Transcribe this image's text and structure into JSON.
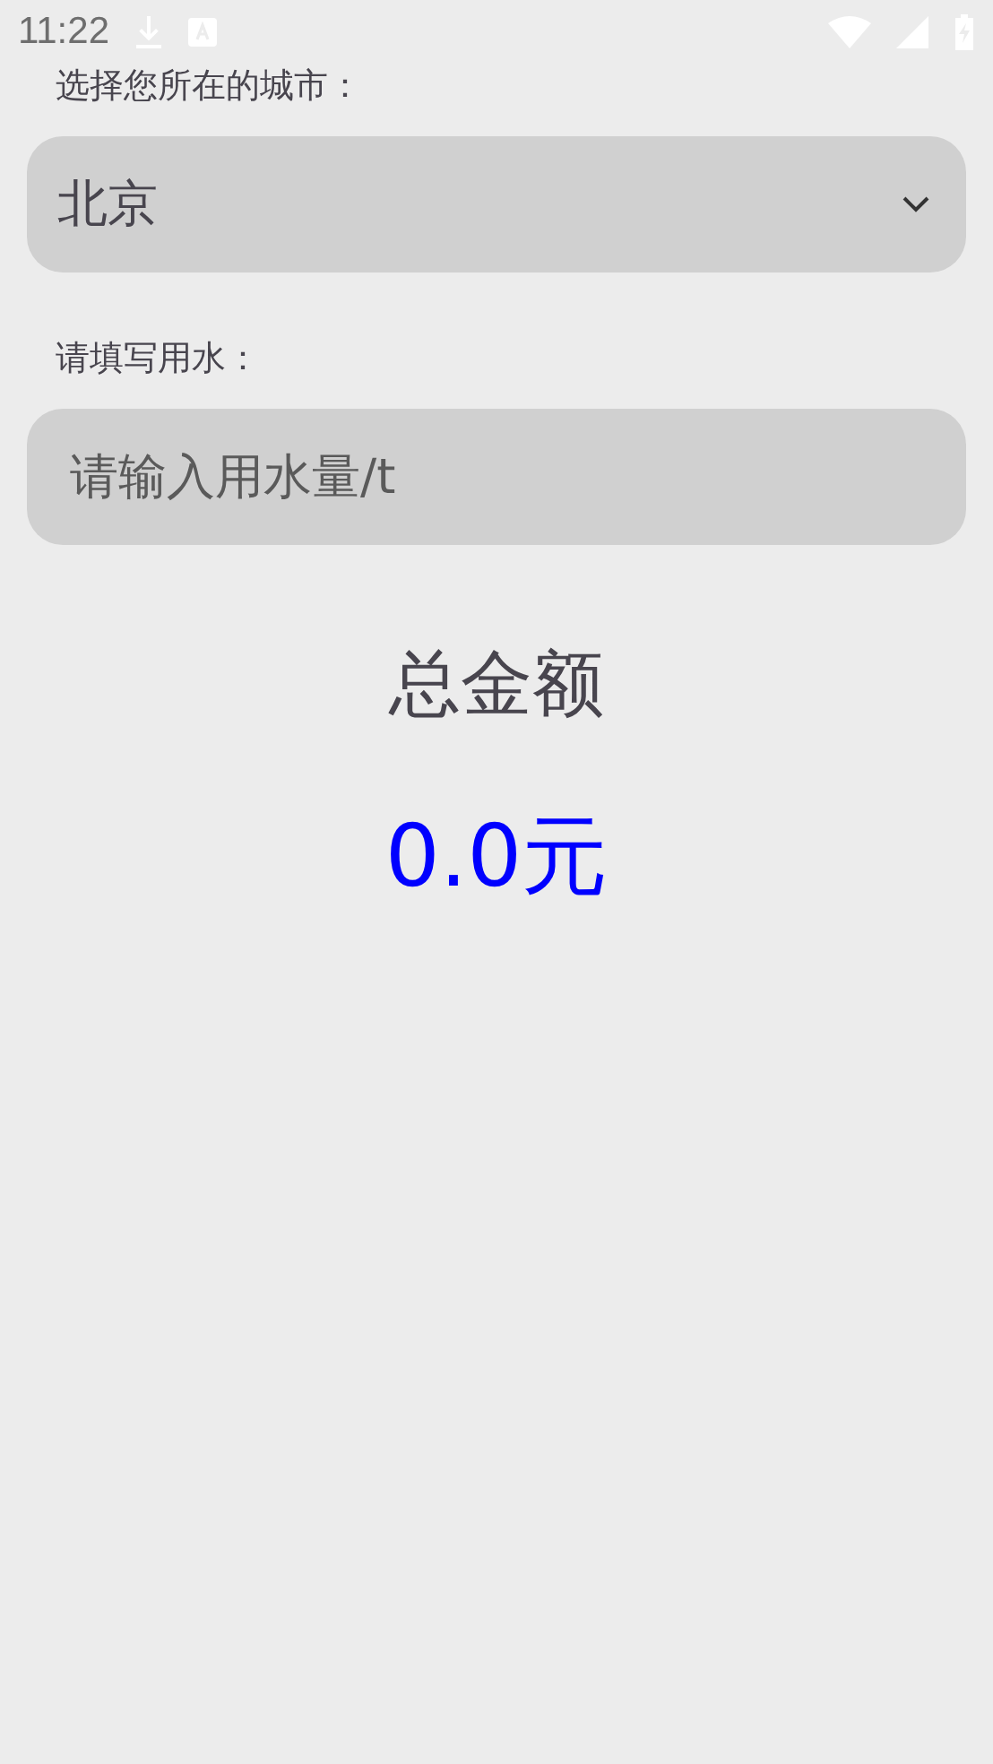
{
  "status_bar": {
    "time": "11:22"
  },
  "city": {
    "label": "选择您所在的城市：",
    "value": "北京"
  },
  "water": {
    "label": "请填写用水：",
    "placeholder": "请输入用水量/t"
  },
  "total": {
    "title": "总金额",
    "amount": "0.0元"
  }
}
